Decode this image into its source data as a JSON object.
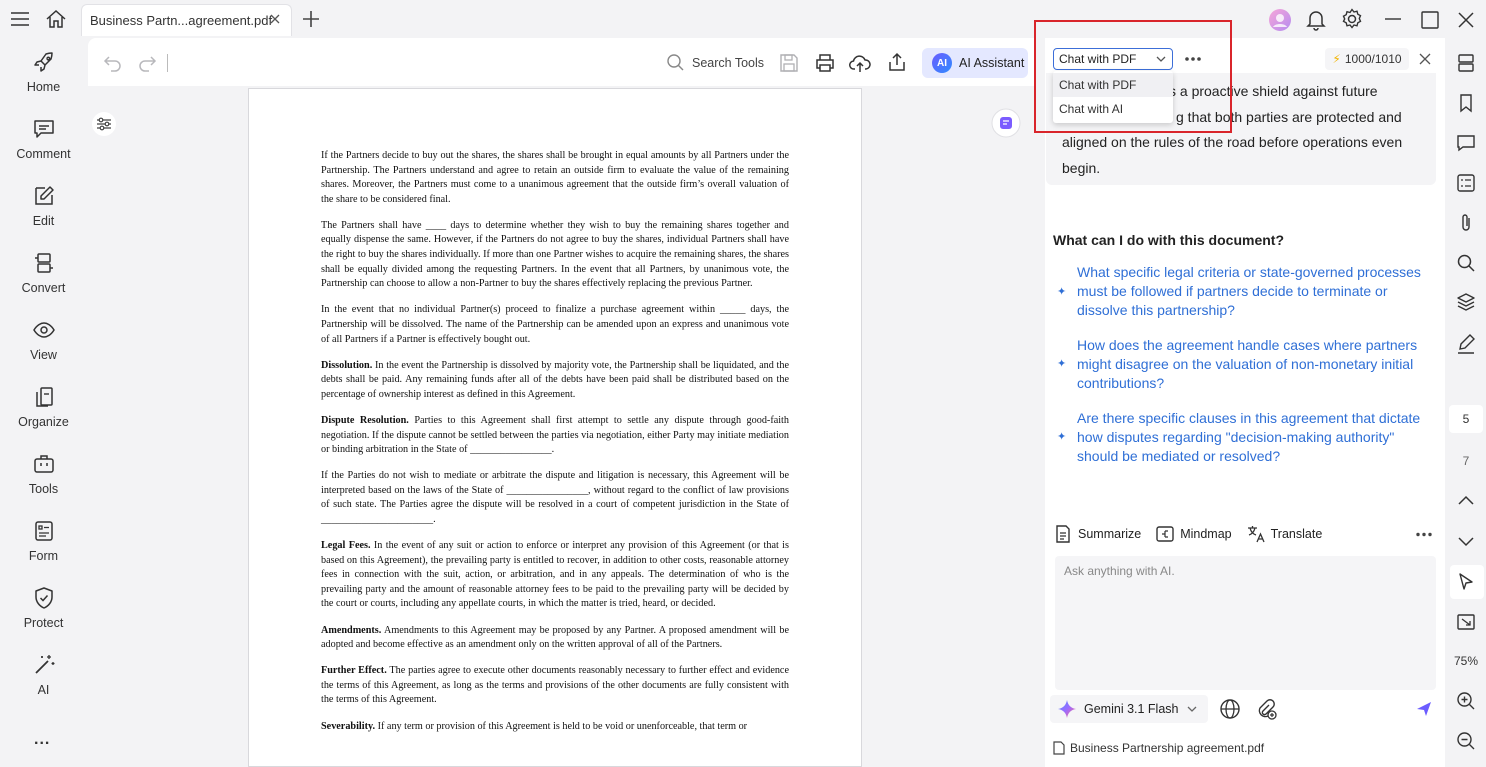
{
  "tab": {
    "title": "Business Partn...agreement.pdf"
  },
  "toolbar": {
    "search_tools": "Search Tools",
    "ai_assistant": "AI Assistant",
    "ai_badge": "AI"
  },
  "sidebar": {
    "items": [
      {
        "label": "Home",
        "icon": "rocket-icon"
      },
      {
        "label": "Comment",
        "icon": "comment-icon"
      },
      {
        "label": "Edit",
        "icon": "edit-icon"
      },
      {
        "label": "Convert",
        "icon": "convert-icon"
      },
      {
        "label": "View",
        "icon": "eye-icon"
      },
      {
        "label": "Organize",
        "icon": "organize-icon"
      },
      {
        "label": "Tools",
        "icon": "toolbox-icon"
      },
      {
        "label": "Form",
        "icon": "form-icon"
      },
      {
        "label": "Protect",
        "icon": "shield-icon"
      },
      {
        "label": "AI",
        "icon": "magic-wand-icon"
      }
    ],
    "more": "..."
  },
  "document": {
    "paragraphs": [
      {
        "heading": "",
        "text": "If the Partners decide to buy out the shares, the shares shall be brought in equal amounts by all Partners under the Partnership. The Partners understand and agree to retain an outside firm to evaluate the value of the remaining shares. Moreover, the Partners must come to a unanimous agreement that the outside firm’s overall valuation of the share to be considered final."
      },
      {
        "heading": "",
        "text": "The Partners shall have ____ days to determine whether they wish to buy the remaining shares together and equally dispense the same. However, if the Partners do not agree to buy the shares, individual Partners shall have the right to buy the shares individually. If more than one Partner wishes to acquire the remaining shares, the shares shall be equally divided among the requesting Partners. In the event that all Partners, by unanimous vote, the Partnership can choose to allow a non-Partner to buy the shares effectively replacing the previous Partner."
      },
      {
        "heading": "",
        "text": "In the event that no individual Partner(s) proceed to finalize a purchase agreement within _____ days, the Partnership will be dissolved. The name of the Partnership can be amended upon an express and unanimous vote of all Partners if a Partner is effectively bought out."
      },
      {
        "heading": "Dissolution.",
        "text": "  In the event the Partnership is dissolved by majority vote, the Partnership shall be liquidated, and the debts shall be paid. Any remaining funds after all of the debts have been paid shall be distributed based on the percentage of ownership interest as defined in this Agreement."
      },
      {
        "heading": "Dispute Resolution.",
        "text": " Parties to this Agreement shall first attempt to settle any dispute through good-faith negotiation. If the dispute cannot be settled between the parties via negotiation, either Party may initiate mediation or binding arbitration in the State of ________________."
      },
      {
        "heading": "",
        "text": "If the Parties do not wish to mediate or arbitrate the dispute and litigation is necessary, this Agreement will be interpreted based on the laws of the State of ________________, without regard to the conflict of law provisions of such state. The Parties agree the dispute will be resolved in a court of competent jurisdiction in the State of ______________________."
      },
      {
        "heading": "Legal Fees.",
        "text": " In the event of any suit or action to enforce or interpret any provision of this Agreement (or that is based on this Agreement), the prevailing party is entitled to recover, in addition to other costs, reasonable attorney fees in connection with the suit, action, or arbitration, and in any appeals. The determination of who is the prevailing party and the amount of reasonable attorney fees to be paid to the prevailing party will be decided by the court or courts, including any appellate courts, in which the matter is tried, heard, or decided."
      },
      {
        "heading": "Amendments.",
        "text": "  Amendments to this Agreement may be proposed by any Partner. A proposed amendment will be adopted and become effective as an amendment only on the written approval of all of the Partners."
      },
      {
        "heading": "Further Effect.",
        "text": "  The parties agree to execute other documents reasonably necessary to further effect and evidence the terms of this Agreement, as long as the terms and provisions of the other documents are fully consistent with the terms of this Agreement."
      },
      {
        "heading": "Severability.",
        "text": "  If any term or provision of this Agreement is held to be void or unenforceable, that term or"
      }
    ]
  },
  "ai_panel": {
    "mode_selected": "Chat with PDF",
    "mode_options": [
      "Chat with PDF",
      "Chat with AI"
    ],
    "quota": "1000/1010",
    "answer_lines": [
      "s a proactive shield against future",
      "g that both parties are protected and",
      "aligned on the rules of the road before operations even",
      "begin."
    ],
    "questions_heading": "What can I do with this document?",
    "questions": [
      "What specific legal criteria or state-governed processes must be followed if partners decide to terminate or dissolve this partnership?",
      "How does the agreement handle cases where partners might disagree on the valuation of non-monetary initial contributions?",
      "Are there specific clauses in this agreement that dictate how disputes regarding \"decision-making authority\" should be mediated or resolved?"
    ],
    "actions": {
      "summarize": "Summarize",
      "mindmap": "Mindmap",
      "translate": "Translate"
    },
    "ask_placeholder": "Ask anything with AI.",
    "model": "Gemini 3.1 Flash",
    "file": "Business Partnership agreement.pdf"
  },
  "right_bar": {
    "page_current": "5",
    "page_next": "7",
    "zoom": "75%"
  },
  "colors": {
    "accent": "#2f6fd6",
    "highlight_box": "#d9252b",
    "ai_button_bg": "#e4e8ff"
  }
}
